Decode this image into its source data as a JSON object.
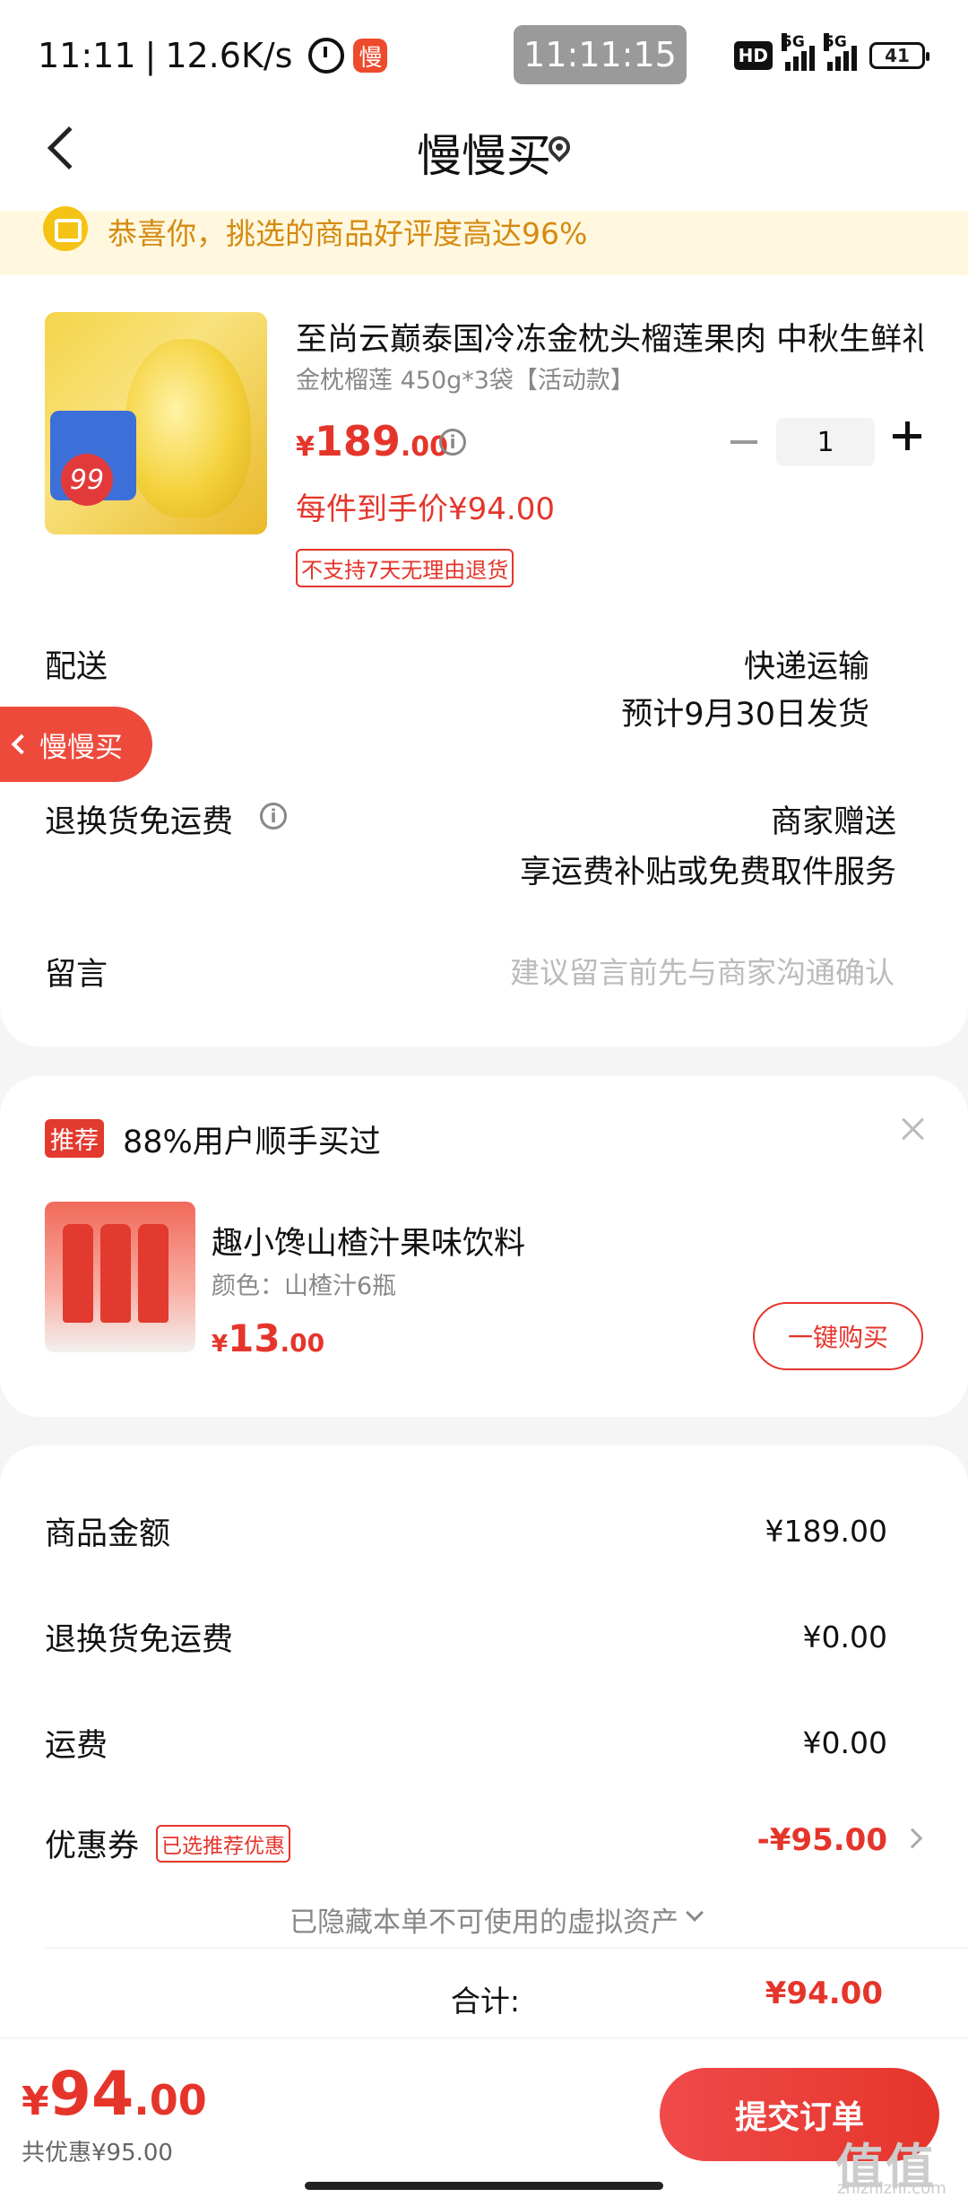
{
  "status_bar": {
    "time": "11:11",
    "speed": "12.6K/s",
    "app_badge": "慢",
    "clock_overlay": "11:11:15",
    "hd_label": "HD",
    "net1": "5G",
    "net2": "5G",
    "battery": "41"
  },
  "nav": {
    "title": "慢慢买"
  },
  "banner": {
    "text": "恭喜你，挑选的商品好评度高达96%"
  },
  "product": {
    "title": "至尚云巅泰国冷冻金枕头榴莲果肉 中秋生鲜礼盒",
    "spec": "金枕榴莲 450g*3袋【活动款】",
    "price_symbol": "¥",
    "price_int": "189",
    "price_dec": ".00",
    "each_price": "每件到手价¥94.00",
    "return_tag": "不支持7天无理由退货",
    "quantity": "1",
    "thumb_price": "99"
  },
  "delivery": {
    "label": "配送",
    "method": "快递运输",
    "eta": "预计9月30日发货"
  },
  "floating_tab": {
    "label": "慢慢买"
  },
  "return_freight": {
    "label": "退换货免运费",
    "value1": "商家赠送",
    "value2": "享运费补贴或免费取件服务"
  },
  "remark": {
    "label": "留言",
    "placeholder": "建议留言前先与商家沟通确认"
  },
  "recommend": {
    "badge": "推荐",
    "title": "88%用户顺手买过",
    "item_name": "趣小馋山楂汁果味饮料",
    "item_spec": "颜色：山楂汁6瓶",
    "price_symbol": "¥",
    "price_int": "13",
    "price_dec": ".00",
    "buy_label": "一键购买"
  },
  "summary": {
    "goods_label": "商品金额",
    "goods_value": "¥189.00",
    "return_label": "退换货免运费",
    "return_value": "¥0.00",
    "freight_label": "运费",
    "freight_value": "¥0.00",
    "coupon_label": "优惠券",
    "coupon_tag": "已选推荐优惠",
    "coupon_value": "-¥95.00",
    "hidden_note": "已隐藏本单不可使用的虚拟资产",
    "total_label": "合计:",
    "total_value": "¥94.00"
  },
  "bottom_bar": {
    "price_symbol": "¥",
    "price_int": "94",
    "price_dec": ".00",
    "saved": "共优惠¥95.00",
    "submit_label": "提交订单"
  },
  "watermark": {
    "mark": "值值值",
    "site": "zhizhizhi.com"
  },
  "colors": {
    "accent": "#e5352b",
    "banner_text": "#d58a10",
    "banner_bg": "#fff8df"
  }
}
